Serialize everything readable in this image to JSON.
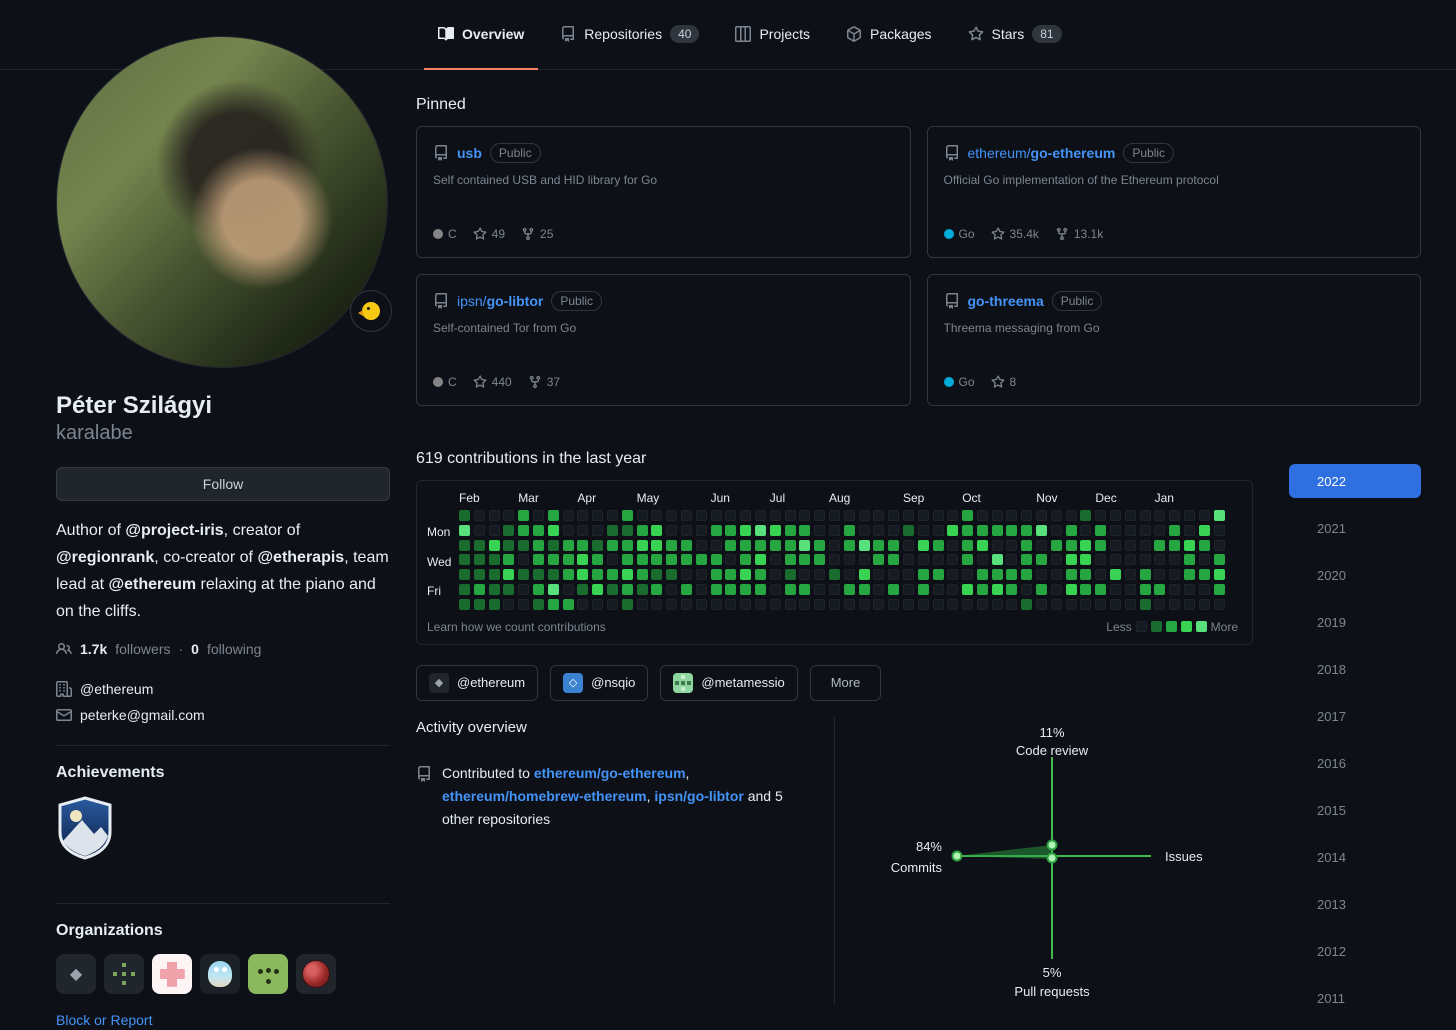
{
  "colors": {
    "accent_blue": "#2f6fe0",
    "accent_orange": "#f78166",
    "link_blue": "#4493f8",
    "radar_green": "#3fb950",
    "go_language": "#00ADD8",
    "c_language": "#858585"
  },
  "header": {
    "tabs": [
      {
        "label": "Overview",
        "count": "",
        "active": true
      },
      {
        "label": "Repositories",
        "count": "40",
        "active": false
      },
      {
        "label": "Projects",
        "count": "",
        "active": false
      },
      {
        "label": "Packages",
        "count": "",
        "active": false
      },
      {
        "label": "Stars",
        "count": "81",
        "active": false
      }
    ]
  },
  "profile": {
    "name": "Péter Szilágyi",
    "username": "karalabe",
    "follow_label": "Follow",
    "bio_parts": [
      {
        "text": "Author of ",
        "bold": false
      },
      {
        "text": "@project-iris",
        "bold": true
      },
      {
        "text": ", creator of ",
        "bold": false
      },
      {
        "text": "@regionrank",
        "bold": true
      },
      {
        "text": ", co-creator of ",
        "bold": false
      },
      {
        "text": "@etherapis",
        "bold": true
      },
      {
        "text": ", team lead at ",
        "bold": false
      },
      {
        "text": "@ethereum",
        "bold": true
      },
      {
        "text": " relaxing at the piano and on the cliffs.",
        "bold": false
      }
    ],
    "followers": "1.7k",
    "followers_label": "followers",
    "dot_separator": "·",
    "following": "0",
    "following_label": "following",
    "organization": "@ethereum",
    "email": "peterke@gmail.com",
    "achievements_title": "Achievements",
    "achievement_badges": [
      "arctic-code-vault-badge"
    ],
    "organizations_title": "Organizations",
    "org_avatars": [
      "ethereum-diamond",
      "green-circuit",
      "pink-pattern",
      "blue-gopher",
      "green-face",
      "red-virus"
    ],
    "block_report_label": "Block or Report"
  },
  "pinned": {
    "title": "Pinned",
    "repos": [
      {
        "owner": "",
        "name": "usb",
        "visibility": "Public",
        "description": "Self contained USB and HID library for Go",
        "language": "C",
        "language_color": "#858585",
        "stars": "49",
        "forks": "25"
      },
      {
        "owner": "ethereum/",
        "name": "go-ethereum",
        "visibility": "Public",
        "description": "Official Go implementation of the Ethereum protocol",
        "language": "Go",
        "language_color": "#00ADD8",
        "stars": "35.4k",
        "forks": "13.1k"
      },
      {
        "owner": "ipsn/",
        "name": "go-libtor",
        "visibility": "Public",
        "description": "Self-contained Tor from Go",
        "language": "C",
        "language_color": "#858585",
        "stars": "440",
        "forks": "37"
      },
      {
        "owner": "",
        "name": "go-threema",
        "visibility": "Public",
        "description": "Threema messaging from Go",
        "language": "Go",
        "language_color": "#00ADD8",
        "stars": "8",
        "forks": ""
      }
    ]
  },
  "contributions": {
    "title": "619 contributions in the last year",
    "months": [
      {
        "label": "Feb",
        "week": 0
      },
      {
        "label": "Mar",
        "week": 4
      },
      {
        "label": "Apr",
        "week": 8
      },
      {
        "label": "May",
        "week": 12
      },
      {
        "label": "Jun",
        "week": 17
      },
      {
        "label": "Jul",
        "week": 21
      },
      {
        "label": "Aug",
        "week": 25
      },
      {
        "label": "Sep",
        "week": 30
      },
      {
        "label": "Oct",
        "week": 34
      },
      {
        "label": "Nov",
        "week": 39
      },
      {
        "label": "Dec",
        "week": 43
      },
      {
        "label": "Jan",
        "week": 47
      }
    ],
    "day_labels": [
      {
        "label": "Mon",
        "row": 1
      },
      {
        "label": "Wed",
        "row": 3
      },
      {
        "label": "Fri",
        "row": 5
      }
    ],
    "learn_link": "Learn how we count contributions",
    "legend_less": "Less",
    "legend_more": "More",
    "palette": [
      "#161b22",
      "#196c2e",
      "#26a641",
      "#39d353",
      "#58e07c"
    ],
    "weeks": [
      "1411111",
      "0011121",
      "0031111",
      "0112310",
      "2210100",
      "0222121",
      "2312142",
      "0022202",
      "0023310",
      "0012230",
      "0120210",
      "2122321",
      "0232210",
      "0332120",
      "0022100",
      "0022020",
      "0002000",
      "0202220",
      "0220220",
      "0322320",
      "0423220",
      "0320000",
      "0222120",
      "0242020",
      "0022000",
      "0000100",
      "0220020",
      "0040320",
      "0022000",
      "0022020",
      "0100000",
      "0030220",
      "0020200",
      "0300000",
      "2222030",
      "0230220",
      "0204230",
      "0200220",
      "0222201",
      "0402020",
      "0020000",
      "0223230",
      "1033220",
      "0220020",
      "0000300",
      "0000000",
      "0000221",
      "0020020",
      "0220000",
      "0032200",
      "0320200",
      "4002320"
    ]
  },
  "org_filters": [
    {
      "label": "@ethereum",
      "icon": "ethereum"
    },
    {
      "label": "@nsqio",
      "icon": "nsqio"
    },
    {
      "label": "@metamessio",
      "icon": "metamessio"
    },
    {
      "label": "More",
      "icon": ""
    }
  ],
  "activity": {
    "title": "Activity overview",
    "contributed_parts": [
      {
        "text": "Contributed to ",
        "link": false
      },
      {
        "text": "ethereum/go-ethereum",
        "link": true
      },
      {
        "text": ", ",
        "link": false
      },
      {
        "text": "ethereum/homebrew-ethereum",
        "link": true
      },
      {
        "text": ", ",
        "link": false
      },
      {
        "text": "ipsn/go-libtor",
        "link": true
      },
      {
        "text": " and 5 other repositories",
        "link": false
      }
    ]
  },
  "chart_data": {
    "type": "radar",
    "title": "Activity overview breakdown",
    "axes": [
      {
        "label": "Code review",
        "percent": 11,
        "display": "11%",
        "position": "top"
      },
      {
        "label": "Issues",
        "percent": null,
        "display": "",
        "position": "right"
      },
      {
        "label": "Pull requests",
        "percent": 5,
        "display": "5%",
        "position": "bottom"
      },
      {
        "label": "Commits",
        "percent": 84,
        "display": "84%",
        "position": "left"
      }
    ],
    "line_color": "#3fb950",
    "legend_position": "none",
    "grid": false
  },
  "years": {
    "items": [
      {
        "label": "2022",
        "active": true
      },
      {
        "label": "2021",
        "active": false
      },
      {
        "label": "2020",
        "active": false
      },
      {
        "label": "2019",
        "active": false
      },
      {
        "label": "2018",
        "active": false
      },
      {
        "label": "2017",
        "active": false
      },
      {
        "label": "2016",
        "active": false
      },
      {
        "label": "2015",
        "active": false
      },
      {
        "label": "2014",
        "active": false
      },
      {
        "label": "2013",
        "active": false
      },
      {
        "label": "2012",
        "active": false
      },
      {
        "label": "2011",
        "active": false
      }
    ]
  }
}
